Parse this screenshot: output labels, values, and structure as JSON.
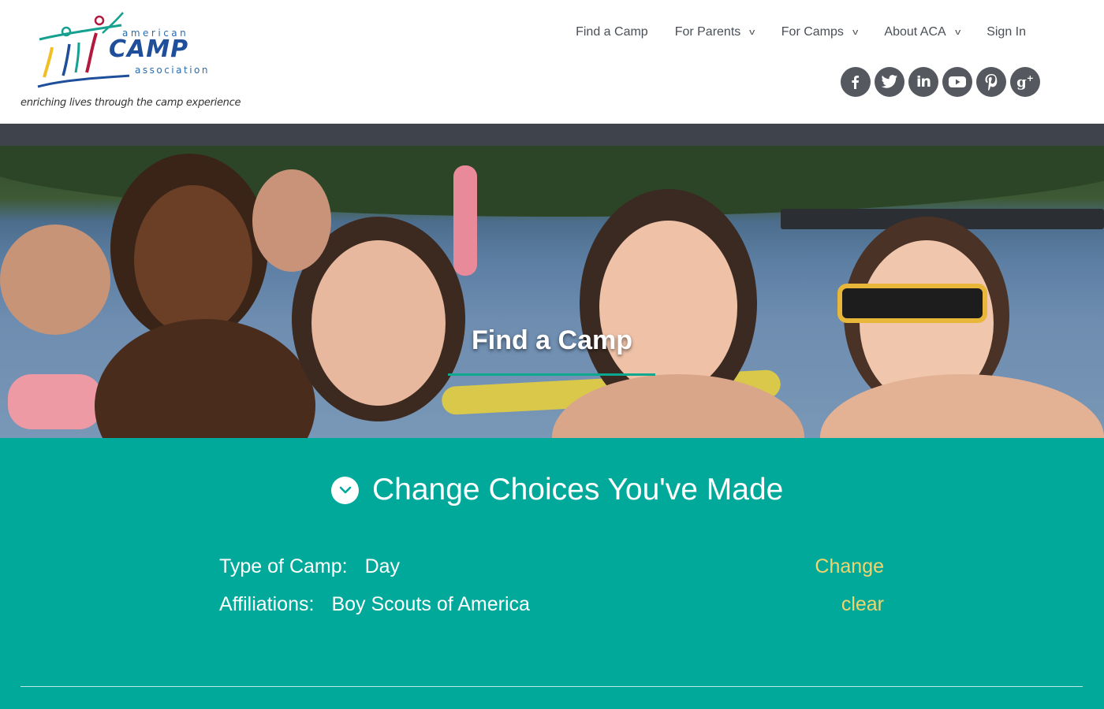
{
  "logo": {
    "word_top": "american",
    "word_main": "CAMP",
    "word_bottom": "association",
    "tagline": "enriching lives through the camp experience"
  },
  "nav": {
    "items": [
      {
        "label": "Find a Camp",
        "dropdown": false
      },
      {
        "label": "For Parents",
        "dropdown": true
      },
      {
        "label": "For Camps",
        "dropdown": true
      },
      {
        "label": "About ACA",
        "dropdown": true
      },
      {
        "label": "Sign In",
        "dropdown": false
      }
    ],
    "caret": "v"
  },
  "social": {
    "icons": [
      {
        "name": "facebook-icon",
        "glyph": "f"
      },
      {
        "name": "twitter-icon",
        "glyph": "t"
      },
      {
        "name": "linkedin-icon",
        "glyph": "in"
      },
      {
        "name": "youtube-icon",
        "glyph": "▶"
      },
      {
        "name": "pinterest-icon",
        "glyph": "P"
      },
      {
        "name": "google-plus-icon",
        "glyph": "g+"
      }
    ],
    "color": "#55595f"
  },
  "hero": {
    "title": "Find a Camp"
  },
  "choices": {
    "title": "Change Choices You've Made",
    "rows": [
      {
        "label": "Type of Camp:",
        "value": "Day",
        "action": "Change"
      },
      {
        "label": "Affiliations:",
        "value": "Boy Scouts of America",
        "action": "clear"
      }
    ]
  },
  "colors": {
    "teal": "#00a99a",
    "accent_yellow": "#f2d46d",
    "dark_strip": "#3f444c",
    "nav_text": "#4a4f57"
  }
}
